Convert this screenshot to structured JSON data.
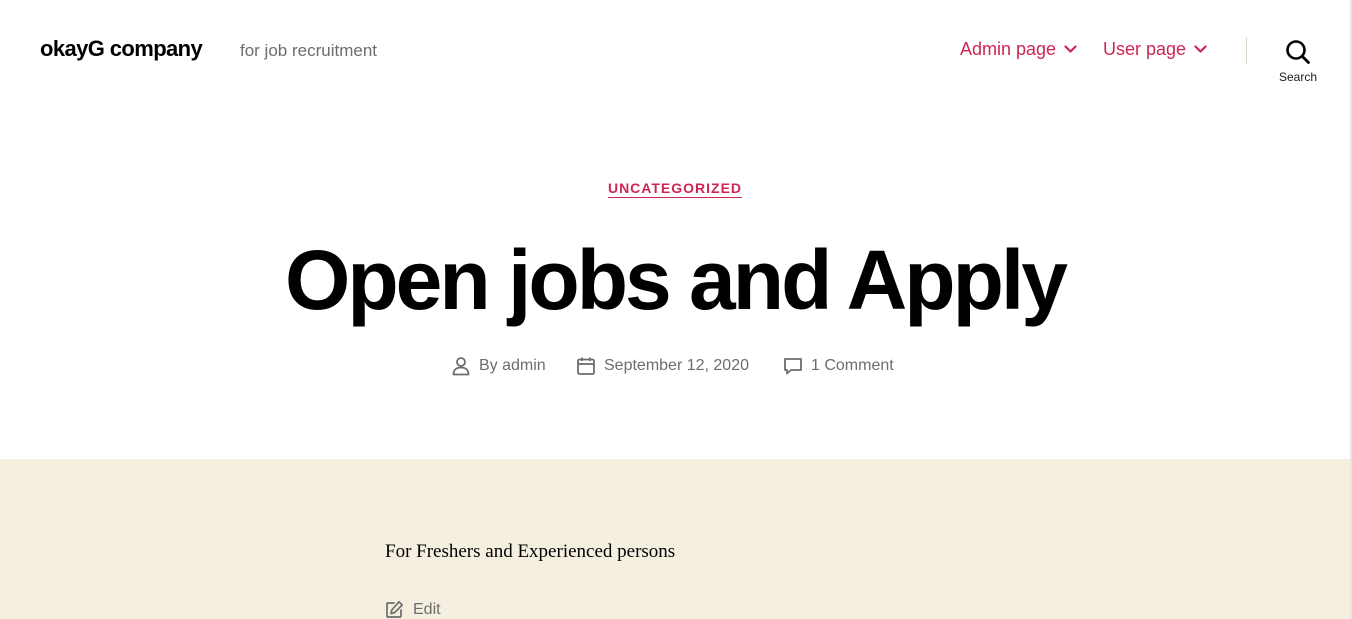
{
  "site": {
    "title": "okayG company",
    "description": "for job recruitment"
  },
  "nav": {
    "items": [
      {
        "label": "Admin page"
      },
      {
        "label": "User page"
      }
    ],
    "search_label": "Search"
  },
  "post": {
    "category": "UNCATEGORIZED",
    "title": "Open jobs and Apply",
    "meta": {
      "author": "By admin",
      "date": "September 12, 2020",
      "comments": "1 Comment"
    },
    "content": "For Freshers and Experienced persons",
    "edit_label": "Edit"
  },
  "colors": {
    "accent": "#cd2653",
    "content_background": "#f5efe0",
    "muted_text": "#6d6d6d"
  },
  "icons": [
    "chevron-down-icon",
    "search-icon",
    "user-icon",
    "calendar-icon",
    "comment-icon",
    "edit-icon"
  ]
}
